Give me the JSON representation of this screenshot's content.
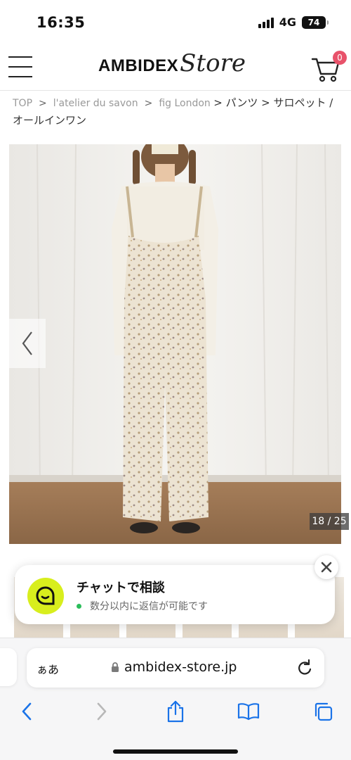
{
  "status_bar": {
    "time": "16:35",
    "network": "4G",
    "battery": "74"
  },
  "header": {
    "logo_main": "AMBIDEX",
    "logo_script": "Store",
    "cart_count": "0",
    "accent_color": "#e8526a"
  },
  "breadcrumb": {
    "items": [
      "TOP",
      "l'atelier du savon",
      "fig London"
    ],
    "separator": ">",
    "tail": "> パンツ > サロペット / オールインワン"
  },
  "product": {
    "image_counter": "18 / 25",
    "image_description_icon": "product-photo"
  },
  "chat": {
    "title": "チャットで相談",
    "status": "数分以内に返信が可能です",
    "avatar_color": "#d8ee1d",
    "online_color": "#2bbd5a"
  },
  "browser": {
    "aa_label": "ぁあ",
    "url": "ambidex-store.jp"
  }
}
